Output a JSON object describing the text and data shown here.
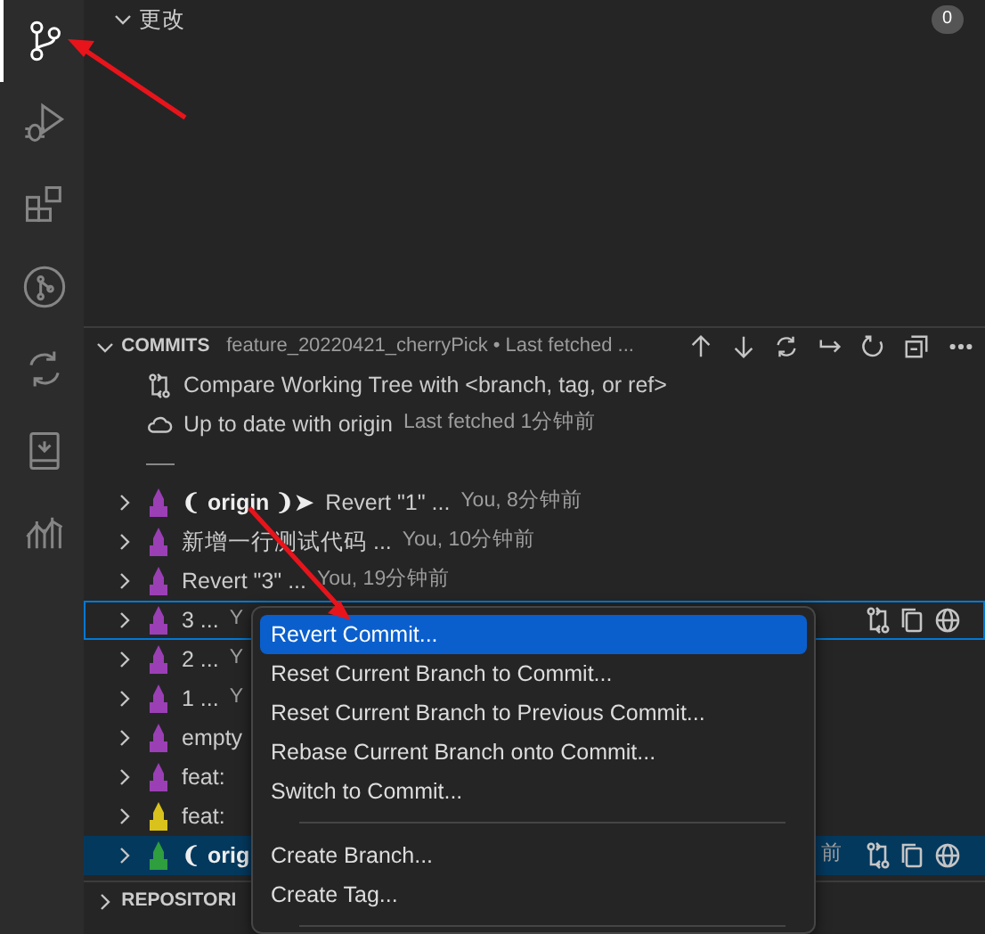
{
  "activity_bar": [
    {
      "kind": "source-control",
      "selected": true
    },
    {
      "kind": "debug",
      "selected": false
    },
    {
      "kind": "extensions",
      "selected": false
    },
    {
      "kind": "graph",
      "selected": false
    },
    {
      "kind": "sync",
      "selected": false
    },
    {
      "kind": "book",
      "selected": false
    },
    {
      "kind": "chart",
      "selected": false
    }
  ],
  "changes": {
    "title": "更改",
    "count": "0",
    "expanded": true
  },
  "commits": {
    "title": "COMMITS",
    "branch": "feature_20220421_cherryPick • Last fetched ...",
    "expanded": true,
    "actions": [
      {
        "kind": "up"
      },
      {
        "kind": "down"
      },
      {
        "kind": "sync"
      },
      {
        "kind": "redirect"
      },
      {
        "kind": "refresh"
      },
      {
        "kind": "collapse"
      },
      {
        "kind": "more"
      }
    ],
    "items": [
      {
        "kind": "action",
        "label": "Compare Working Tree with <branch, tag, or ref>"
      },
      {
        "kind": "status",
        "label": "Up to date with origin",
        "description": "Last fetched 1分钟前"
      },
      {
        "kind": "separator"
      },
      {
        "kind": "commit",
        "color": "#9b3fb5",
        "tag": "❨ origin ❩➤",
        "label": "Revert \"1\" ...",
        "description": "You, 8分钟前",
        "focused": false,
        "selected": false
      },
      {
        "kind": "commit",
        "color": "#9b3fb5",
        "label": "新增一行测试代码 ...",
        "description": "You, 10分钟前",
        "focused": false,
        "selected": false
      },
      {
        "kind": "commit",
        "color": "#9b3fb5",
        "label": "Revert \"3\" ...",
        "description": "You, 19分钟前",
        "focused": false,
        "selected": false
      },
      {
        "kind": "commit",
        "color": "#9b3fb5",
        "label": "3 ...",
        "description": "Y",
        "focused": true,
        "selected": false,
        "row_actions": [
          {
            "kind": "compare"
          },
          {
            "kind": "copy"
          },
          {
            "kind": "globe"
          }
        ]
      },
      {
        "kind": "commit",
        "color": "#9b3fb5",
        "label": "2 ...",
        "description": "Y",
        "focused": false,
        "selected": false
      },
      {
        "kind": "commit",
        "color": "#9b3fb5",
        "label": "1 ...",
        "description": "Y",
        "focused": false,
        "selected": false
      },
      {
        "kind": "commit",
        "color": "#9b3fb5",
        "label": "empty",
        "focused": false,
        "selected": false
      },
      {
        "kind": "commit",
        "color": "#9b3fb5",
        "label": "feat:",
        "focused": false,
        "selected": false
      },
      {
        "kind": "commit",
        "color": "#d9c21c",
        "label": "feat:",
        "focused": false,
        "selected": false
      },
      {
        "kind": "commit",
        "color": "#2e9e3e",
        "tag": "❨ orig",
        "tail": "前",
        "focused": false,
        "selected": true,
        "row_actions": [
          {
            "kind": "compare"
          },
          {
            "kind": "copy"
          },
          {
            "kind": "globe"
          }
        ]
      }
    ]
  },
  "repositories": {
    "title": "REPOSITORI",
    "expanded": false
  },
  "context_menu": {
    "items": [
      {
        "kind": "item",
        "label": "Revert Commit...",
        "selected": true
      },
      {
        "kind": "item",
        "label": "Reset Current Branch to Commit...",
        "selected": false
      },
      {
        "kind": "item",
        "label": "Reset Current Branch to Previous Commit...",
        "selected": false
      },
      {
        "kind": "item",
        "label": "Rebase Current Branch onto Commit...",
        "selected": false
      },
      {
        "kind": "item",
        "label": "Switch to Commit...",
        "selected": false
      },
      {
        "kind": "separator"
      },
      {
        "kind": "item",
        "label": "Create Branch...",
        "selected": false
      },
      {
        "kind": "item",
        "label": "Create Tag...",
        "selected": false
      },
      {
        "kind": "separator"
      }
    ]
  }
}
